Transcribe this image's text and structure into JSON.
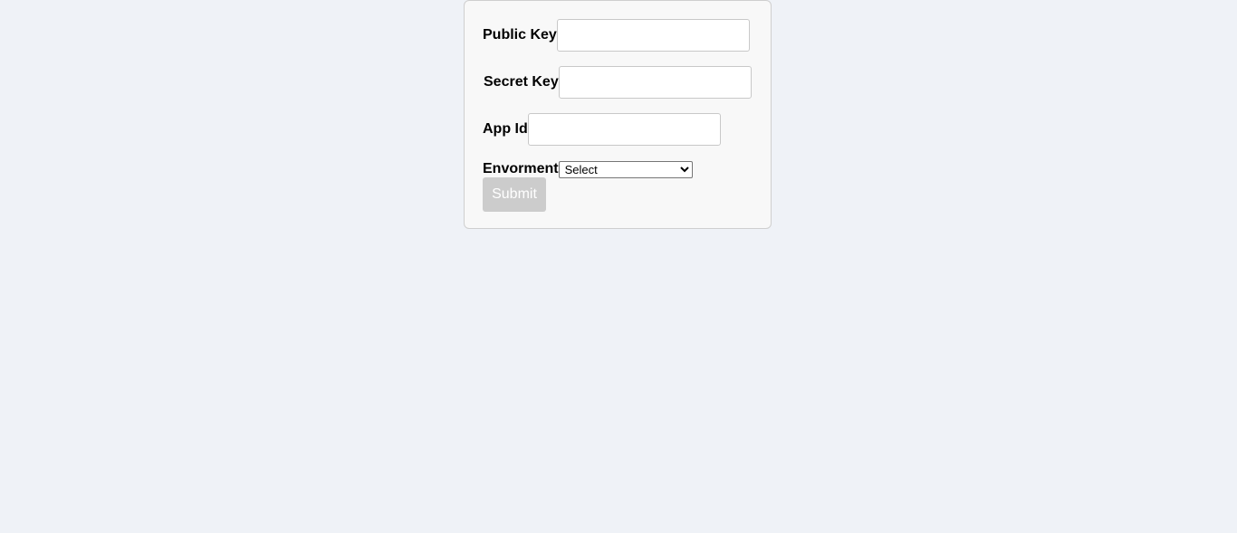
{
  "form": {
    "public_key": {
      "label": "Public Key",
      "value": "",
      "placeholder": ""
    },
    "secret_key": {
      "label": "Secret Key",
      "value": "",
      "placeholder": ""
    },
    "app_id": {
      "label": "App Id",
      "value": "",
      "placeholder": ""
    },
    "environment": {
      "label": "Envorment",
      "selected": "Select",
      "options": [
        "Select"
      ]
    },
    "submit_label": "Submit"
  },
  "colors": {
    "page_background": "#eff2f7",
    "card_background": "#f8f8f8",
    "submit_disabled": "#cccccc"
  }
}
